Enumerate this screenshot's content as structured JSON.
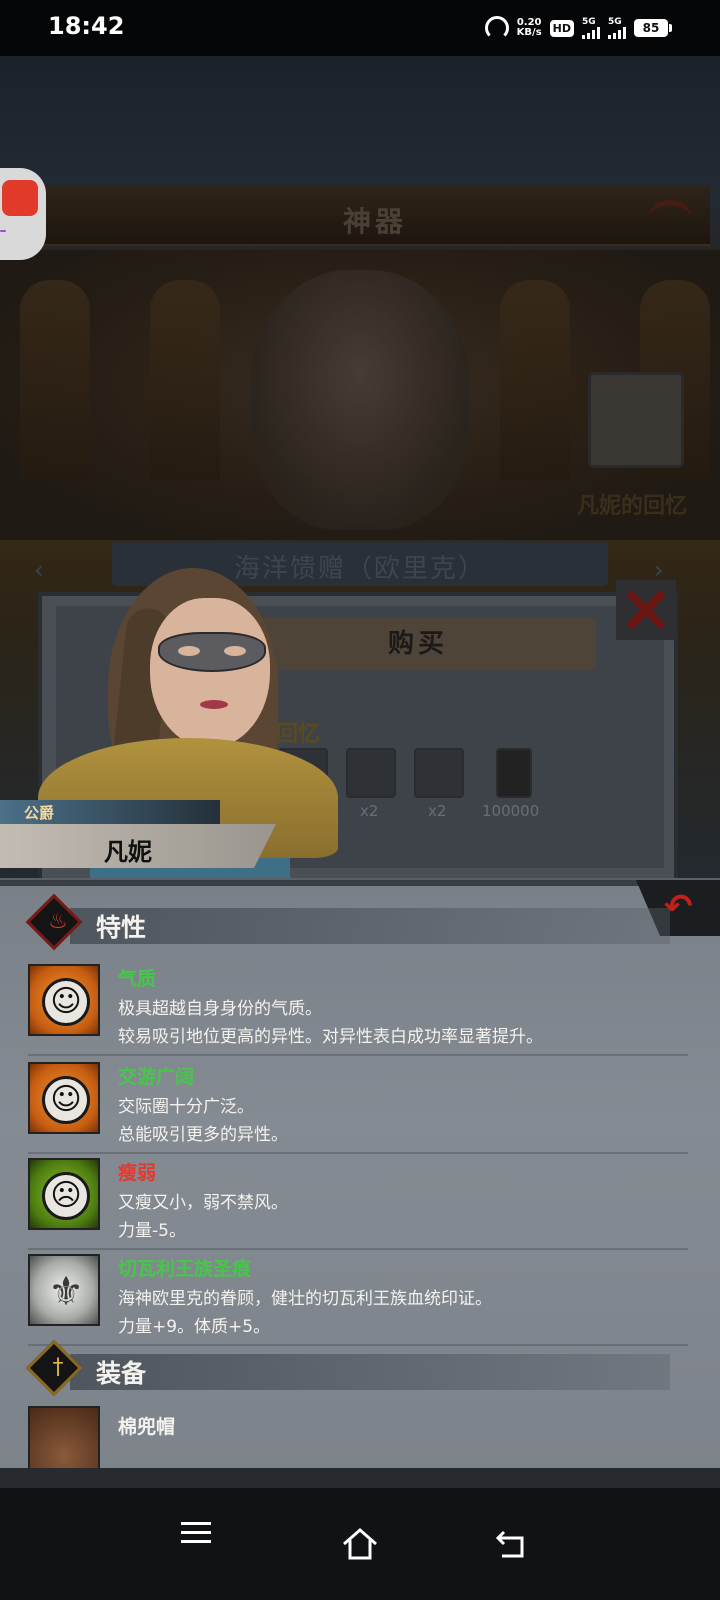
{
  "status_bar": {
    "time": "18:42",
    "net_speed_value": "0.20",
    "net_speed_unit": "KB/s",
    "hd_label": "HD",
    "signal1_label": "5G",
    "signal2_label": "5G",
    "battery": "85"
  },
  "game": {
    "screen_title": "神器",
    "memory_box_label": "凡妮的回忆",
    "banner_text": "海洋馈赠（欧里克）",
    "dialog": {
      "buy_label": "购买",
      "memory_title_partial": "的回忆",
      "costs": [
        {
          "icon": "shell-icon",
          "qty": ""
        },
        {
          "icon": "stone-icon",
          "qty": "x2"
        },
        {
          "icon": "crystal-icon",
          "qty": "x2"
        },
        {
          "icon": "coin-icon",
          "qty": "100000"
        }
      ]
    },
    "character": {
      "rank": "公爵",
      "name": "凡妮"
    },
    "traits_section": {
      "title": "特性",
      "items": [
        {
          "name": "气质",
          "lines": [
            "极具超越自身身份的气质。",
            "较易吸引地位更高的异性。对异性表白成功率显著提升。"
          ],
          "color": "#46c74a"
        },
        {
          "name": "交游广阔",
          "lines": [
            "交际圈十分广泛。",
            "总能吸引更多的异性。"
          ],
          "color": "#46c74a"
        },
        {
          "name": "瘦弱",
          "lines": [
            "又瘦又小，弱不禁风。",
            "力量-5。"
          ],
          "color": "#e23b2e"
        },
        {
          "name": "切瓦利王族圣痕",
          "lines": [
            "海神欧里克的眷顾，健壮的切瓦利王族血统印证。",
            "力量+9。体质+5。"
          ],
          "color": "#46c74a"
        }
      ]
    },
    "equipment_section": {
      "title": "装备",
      "items": [
        {
          "name": "棉兜帽"
        }
      ]
    }
  }
}
